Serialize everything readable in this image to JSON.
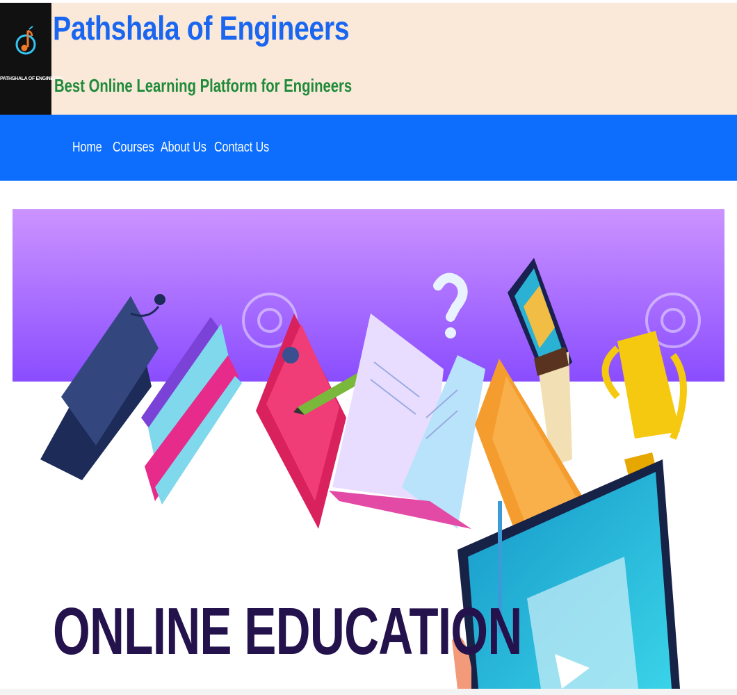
{
  "header": {
    "logo_text": "PATHSHALA OF ENGINEERS",
    "title": "Pathshala of Engineers",
    "tagline": "Best Online Learning Platform for Engineers"
  },
  "nav": {
    "items": [
      "Home",
      "Courses",
      "About Us",
      "Contact Us"
    ]
  },
  "banner": {
    "title": "ONLINE EDUCATION",
    "watermark_icon": "camera-watermark-icon"
  },
  "colors": {
    "header_bg": "#fae9d8",
    "title": "#1a66f0",
    "tagline": "#1e8a3a",
    "nav_bg": "#0d6efd",
    "banner_purple": "#b77cff",
    "banner_title": "#24124d"
  }
}
